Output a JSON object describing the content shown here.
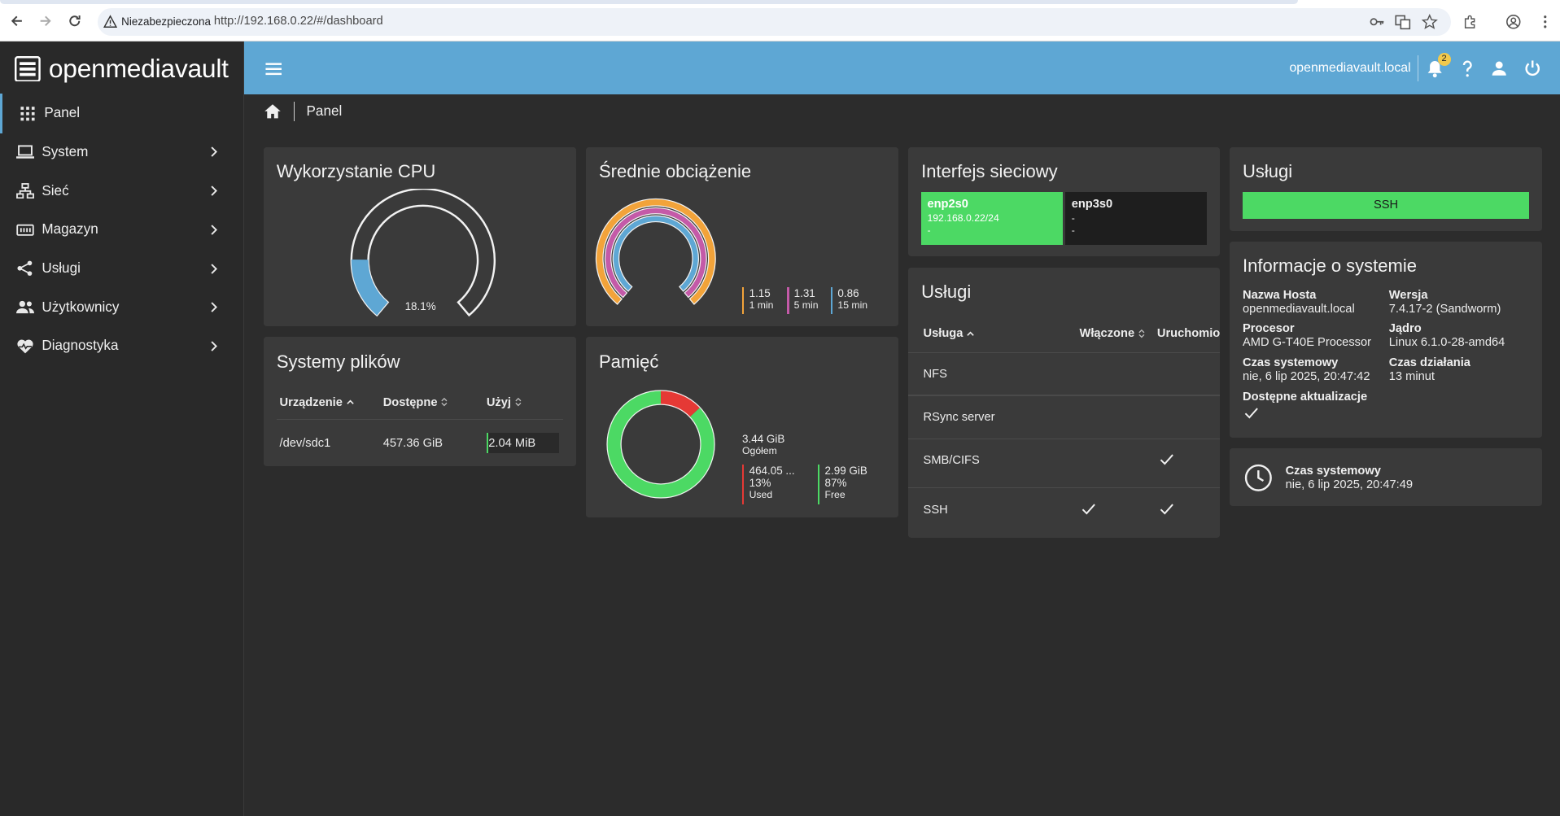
{
  "browser": {
    "security_label": "Niezabezpieczona",
    "url": "http://192.168.0.22/#/dashboard"
  },
  "app": {
    "brand": "openmediavault",
    "hostname": "openmediavault.local",
    "notifications_count": "2"
  },
  "sidebar": {
    "items": [
      {
        "label": "Panel",
        "icon": "grid-icon",
        "active": true
      },
      {
        "label": "System",
        "icon": "laptop-icon"
      },
      {
        "label": "Sieć",
        "icon": "network-icon"
      },
      {
        "label": "Magazyn",
        "icon": "storage-icon"
      },
      {
        "label": "Usługi",
        "icon": "share-icon"
      },
      {
        "label": "Użytkownicy",
        "icon": "users-icon"
      },
      {
        "label": "Diagnostyka",
        "icon": "heart-pulse-icon"
      }
    ]
  },
  "breadcrumb": {
    "current": "Panel"
  },
  "cpu": {
    "title": "Wykorzystanie CPU",
    "value_label": "18.1%",
    "value": 18.1
  },
  "load": {
    "title": "Średnie obciążenie",
    "items": [
      {
        "value": "1.15",
        "label": "1 min",
        "color": "#f2a33a"
      },
      {
        "value": "1.31",
        "label": "5 min",
        "color": "#c45aa8"
      },
      {
        "value": "0.86",
        "label": "15 min",
        "color": "#5ea7d4"
      }
    ]
  },
  "network": {
    "title": "Interfejs sieciowy",
    "interfaces": [
      {
        "name": "enp2s0",
        "line1": "192.168.0.22/24",
        "line2": "-",
        "color": "#4cd964"
      },
      {
        "name": "enp3s0",
        "line1": "-",
        "line2": "-",
        "color": "#1e1e1e"
      }
    ]
  },
  "services_top": {
    "title": "Usługi",
    "items": [
      {
        "label": "SSH",
        "color": "#4cd964"
      }
    ]
  },
  "filesystems": {
    "title": "Systemy plików",
    "headers": [
      "Urządzenie",
      "Dostępne",
      "Użyj"
    ],
    "rows": [
      {
        "device": "/dev/sdc1",
        "available": "457.36 GiB",
        "used": "2.04 MiB"
      }
    ]
  },
  "memory": {
    "title": "Pamięć",
    "total_value": "3.44 GiB",
    "total_label": "Ogółem",
    "used_value": "464.05 ...",
    "used_pct": "13%",
    "used_label": "Used",
    "free_value": "2.99 GiB",
    "free_pct": "87%",
    "free_label": "Free",
    "used_fraction": 0.13,
    "used_color": "#e53935",
    "free_color": "#4cd964"
  },
  "services": {
    "title": "Usługi",
    "headers": [
      "Usługa",
      "Włączone",
      "Uruchomion"
    ],
    "rows": [
      {
        "name": "NFS",
        "enabled": false,
        "running": false
      },
      {
        "name": "RSync server",
        "enabled": false,
        "running": false
      },
      {
        "name": "SMB/CIFS",
        "enabled": false,
        "running": true
      },
      {
        "name": "SSH",
        "enabled": true,
        "running": true
      }
    ]
  },
  "sysinfo": {
    "title": "Informacje o systemie",
    "hostname_label": "Nazwa Hosta",
    "hostname_value": "openmediavault.local",
    "version_label": "Wersja",
    "version_value": "7.4.17-2 (Sandworm)",
    "cpu_label": "Procesor",
    "cpu_value": "AMD G-T40E Processor",
    "kernel_label": "Jądro",
    "kernel_value": "Linux 6.1.0-28-amd64",
    "time_label": "Czas systemowy",
    "time_value": "nie, 6 lip 2025, 20:47:42",
    "uptime_label": "Czas działania",
    "uptime_value": "13 minut",
    "updates_label": "Dostępne aktualizacje"
  },
  "clock": {
    "label": "Czas systemowy",
    "value": "nie, 6 lip 2025, 20:47:49"
  }
}
